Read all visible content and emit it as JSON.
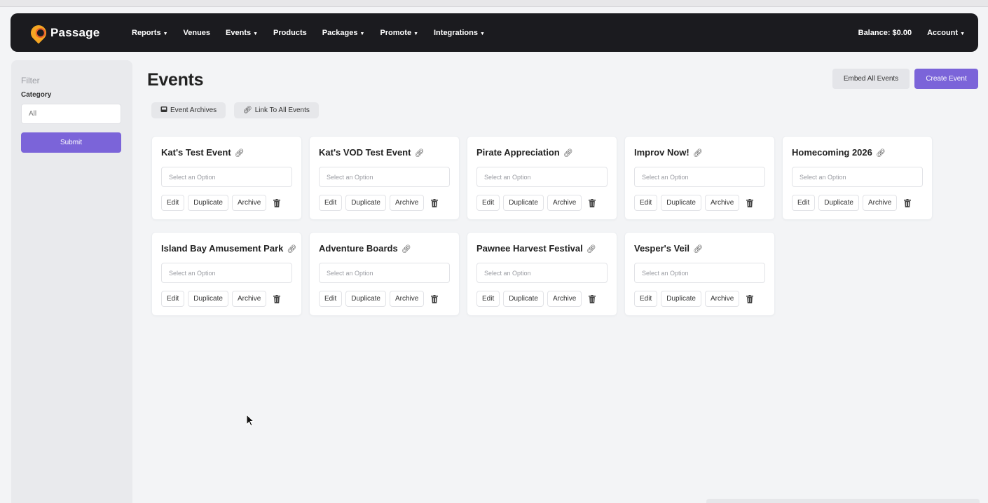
{
  "nav": {
    "brand": "Passage",
    "items": [
      {
        "label": "Reports",
        "caret": true
      },
      {
        "label": "Venues",
        "caret": false
      },
      {
        "label": "Events",
        "caret": true
      },
      {
        "label": "Products",
        "caret": false
      },
      {
        "label": "Packages",
        "caret": true
      },
      {
        "label": "Promote",
        "caret": true
      },
      {
        "label": "Integrations",
        "caret": true
      }
    ],
    "balance": "Balance: $0.00",
    "account": "Account"
  },
  "sidebar": {
    "heading": "Filter",
    "category_label": "Category",
    "category_value": "All",
    "submit_label": "Submit"
  },
  "header": {
    "title": "Events",
    "embed_label": "Embed All Events",
    "create_label": "Create Event",
    "archives_label": "Event Archives",
    "link_all_label": "Link To All Events"
  },
  "card_labels": {
    "select_placeholder": "Select an Option",
    "edit": "Edit",
    "duplicate": "Duplicate",
    "archive": "Archive"
  },
  "events": [
    "Kat's Test Event",
    "Kat's VOD Test Event",
    "Pirate Appreciation",
    "Improv Now!",
    "Homecoming 2026",
    "Island Bay Amusement Park",
    "Adventure Boards",
    "Pawnee Harvest Festival",
    "Vesper's Veil"
  ],
  "colors": {
    "accent": "#7b64d9",
    "navbar": "#1b1b1f",
    "brand_mark": "#f5a623"
  }
}
